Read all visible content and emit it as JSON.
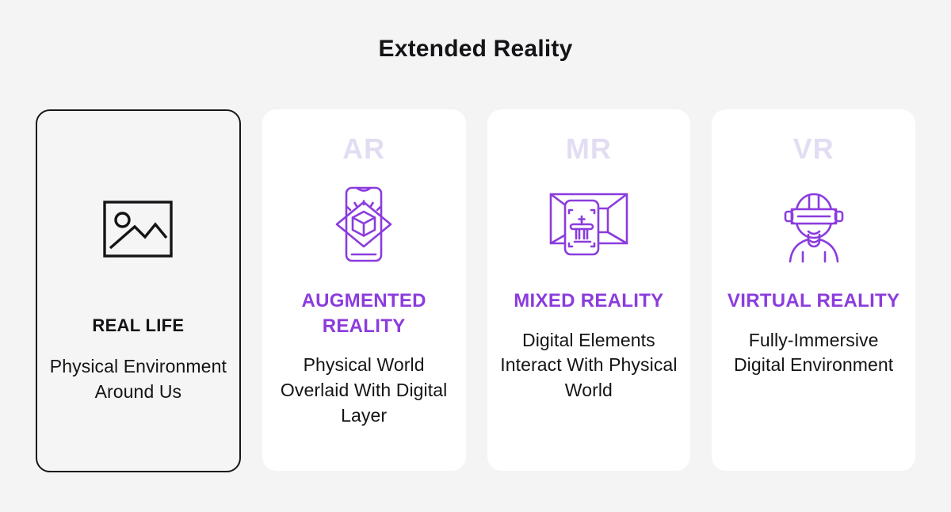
{
  "header": {
    "title": "Extended Reality"
  },
  "colors": {
    "page_background": "#f4f4f5",
    "card_background": "#ffffff",
    "accent_purple": "#8b3cdd",
    "watermark_purple": "#e3ddf3",
    "text_dark": "#141417",
    "border_dark": "#17171a"
  },
  "cards": [
    {
      "id": "real-life",
      "watermark": "",
      "icon": "image-photo-icon",
      "heading": "REAL LIFE",
      "description": "Physical Environment Around Us",
      "description_lines": [
        "Physical",
        "Environment",
        "Around Us"
      ]
    },
    {
      "id": "augmented-reality",
      "watermark": "AR",
      "icon": "phone-ar-cube-icon",
      "heading": "AUGMENTED REALITY",
      "heading_lines": [
        "AUGMENTED",
        "REALITY"
      ],
      "description": "Physical World Overlaid With Digital Layer",
      "description_lines": [
        "Physical World",
        "Overlaid With",
        "Digital Layer"
      ]
    },
    {
      "id": "mixed-reality",
      "watermark": "MR",
      "icon": "room-scan-tablet-icon",
      "heading": "MIXED REALITY",
      "heading_lines": [
        "MIXED",
        "REALITY"
      ],
      "description": "Digital Elements Interact With Physical World",
      "description_lines": [
        "Digital Elements",
        "Interact With",
        "Physical World"
      ]
    },
    {
      "id": "virtual-reality",
      "watermark": "VR",
      "icon": "vr-headset-person-icon",
      "heading": "VIRTUAL REALITY",
      "heading_lines": [
        "VIRTUAL",
        "REALITY"
      ],
      "description": "Fully-Immersive Digital Environment",
      "description_lines": [
        "Fully-Immersive",
        "Digital",
        "Environment"
      ]
    }
  ]
}
